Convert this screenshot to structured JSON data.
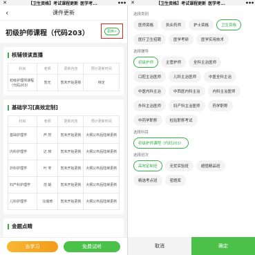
{
  "left_titlebar": {
    "close": "✕",
    "title": "【卫生资格】考试课程更新_医学考...",
    "more": "•••"
  },
  "right_titlebar": {
    "close": "✕",
    "title": "【卫生资格】考试课程更新_医学考...",
    "more": "•••"
  },
  "left": {
    "nav_title": "课件更新",
    "back": "‹",
    "course_title": "初级护师课程（代码203）",
    "switch_label": "更换>",
    "section1": {
      "title": "核辅领读直播",
      "headers": [
        "科目",
        "老师",
        "更新内容",
        "预计更新时间"
      ],
      "rows": [
        [
          "初级护理师课程（代码203）",
          "暂无",
          "暂未开始更新",
          "待定"
        ]
      ]
    },
    "section2": {
      "title": "基础学习[高效定制]",
      "headers": [
        "科目",
        "老师",
        "更新内容",
        "预计更新时间"
      ],
      "rows": [
        [
          "基础护理学",
          "芦 然",
          "暂未开始更新",
          "大纲公布后陆续更新"
        ],
        [
          "内科护理学",
          "达 璋",
          "暂未开始更新",
          "大纲公布后陆续更新"
        ],
        [
          "外科护理学",
          "叶 苓",
          "暂未开始更新",
          "大纲公布后陆续更新"
        ],
        [
          "妇产科护理学",
          "范 娟",
          "暂未开始更新",
          "大纲公布后陆续更新"
        ],
        [
          "儿科护理学",
          "马瑞琦",
          "暂未开始更新",
          "大纲公布后陆续更新"
        ]
      ]
    },
    "section3": {
      "title": "金题点睛"
    },
    "buttons": {
      "study": "去学习",
      "trial": "免费试听"
    }
  },
  "right": {
    "groups": [
      {
        "title": "选择类别",
        "options": [
          "医师资格",
          "执业药师",
          "护士资格",
          "卫生资格",
          "医疗卫生招聘",
          "医学考研",
          "医学实用技术"
        ],
        "selected": "卫生资格"
      },
      {
        "title": "选择辅导",
        "options": [
          "初级护师",
          "主管护师",
          "全科主治医师",
          "口腔主治医师",
          "儿科主治医师",
          "中医全科主治",
          "中医内科主治",
          "中西医内科主治",
          "内科主治医师",
          "外科主治医师",
          "妇产科主治医师",
          "药学职称",
          "中药学职称",
          "检验职称考试"
        ],
        "selected": "初级护师"
      },
      {
        "title": "选择科目",
        "options": [
          "初级护师课程（代码203）"
        ],
        "selected": "初级护师课程（代码203）"
      },
      {
        "title": "选择班次",
        "options": [
          "高效定制班",
          "无忧实验班",
          "超值精品班",
          "精选考点班",
          "密题库"
        ],
        "selected": "高效定制班"
      }
    ],
    "buttons": {
      "cancel": "取消",
      "confirm": "确定"
    }
  },
  "colors": {
    "accent": "#35b04b",
    "highlight_box": "#e2231a",
    "study_button": "#f49b1a"
  }
}
